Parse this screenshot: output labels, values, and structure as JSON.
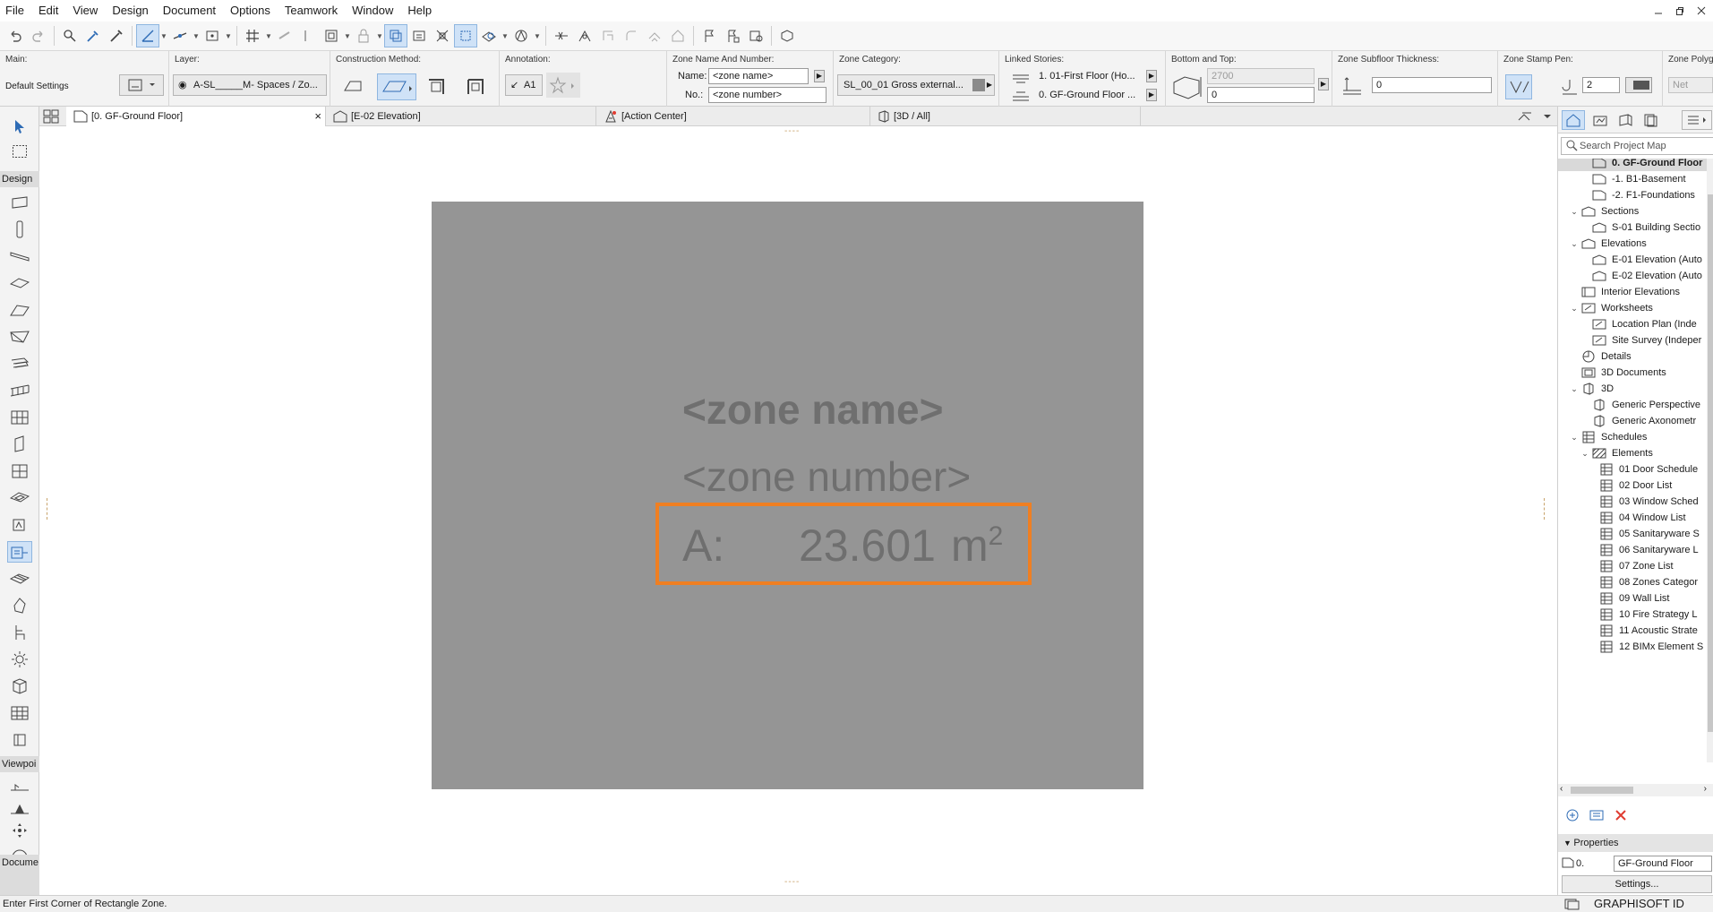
{
  "menu": [
    "File",
    "Edit",
    "View",
    "Design",
    "Document",
    "Options",
    "Teamwork",
    "Window",
    "Help"
  ],
  "window_controls": [
    "minimize-icon",
    "restore-icon",
    "close-icon"
  ],
  "infobox": {
    "main_label": "Main:",
    "main_value": "Default Settings",
    "layer_label": "Layer:",
    "layer_value": "A-SL_____M- Spaces / Zo...",
    "construction_label": "Construction Method:",
    "annotation_label": "Annotation:",
    "annotation_value": "A1",
    "zone_name_label": "Zone Name And Number:",
    "name_label": "Name:",
    "name_value": "<zone name>",
    "no_label": "No.:",
    "no_value": "<zone number>",
    "category_label": "Zone Category:",
    "category_value": "SL_00_01   Gross external...",
    "linked_label": "Linked Stories:",
    "linked_top": "1. 01-First Floor (Ho...",
    "linked_bottom": "0. GF-Ground Floor ...",
    "bt_label": "Bottom and Top:",
    "top_value": "2700",
    "bottom_value": "0",
    "subfloor_label": "Zone Subfloor Thickness:",
    "subfloor_value": "0",
    "stamp_label": "Zone Stamp Pen:",
    "stamp_value": "2",
    "polygon_label": "Zone Polygon",
    "polygon_value": "Net"
  },
  "toolbox": {
    "design_label": "Design",
    "viewpoint_label": "Viewpoi",
    "document_label": "Docume"
  },
  "tabs": [
    {
      "label": "[0. GF-Ground Floor]",
      "close": "×"
    },
    {
      "label": "[E-02 Elevation]"
    },
    {
      "label": "[Action Center]"
    },
    {
      "label": "[3D / All]"
    }
  ],
  "zone_stamp": {
    "name": "<zone name>",
    "number": "<zone number>",
    "area_label": "A:",
    "area_value": "23.601",
    "area_unit": "m",
    "area_unit_power": "2",
    "highlight_color": "#ef7f22",
    "zone_fill": "#959595"
  },
  "handle_marks": "----",
  "navigator": {
    "search_placeholder": "Search Project Map",
    "items": [
      {
        "label": "0. GF-Ground Floor",
        "level": 2,
        "selected": true,
        "icon": "story-icon"
      },
      {
        "label": "-1. B1-Basement",
        "level": 2,
        "icon": "story-icon"
      },
      {
        "label": "-2. F1-Foundations",
        "level": 2,
        "icon": "story-icon"
      },
      {
        "label": "Sections",
        "level": 1,
        "expand": "v",
        "icon": "section-icon"
      },
      {
        "label": "S-01 Building Sectio",
        "level": 2,
        "icon": "section-icon"
      },
      {
        "label": "Elevations",
        "level": 1,
        "expand": "v",
        "icon": "elevation-icon"
      },
      {
        "label": "E-01 Elevation (Auto",
        "level": 2,
        "icon": "elevation-icon"
      },
      {
        "label": "E-02 Elevation (Auto",
        "level": 2,
        "icon": "elevation-icon"
      },
      {
        "label": "Interior Elevations",
        "level": 1,
        "icon": "interior-elevation-icon"
      },
      {
        "label": "Worksheets",
        "level": 1,
        "expand": "v",
        "icon": "worksheet-icon"
      },
      {
        "label": "Location Plan (Inde",
        "level": 2,
        "icon": "worksheet-icon"
      },
      {
        "label": "Site Survey (Indeper",
        "level": 2,
        "icon": "worksheet-icon"
      },
      {
        "label": "Details",
        "level": 1,
        "icon": "detail-icon"
      },
      {
        "label": "3D Documents",
        "level": 1,
        "icon": "3d-document-icon"
      },
      {
        "label": "3D",
        "level": 1,
        "expand": "v",
        "icon": "3d-icon"
      },
      {
        "label": "Generic Perspective",
        "level": 2,
        "icon": "perspective-icon"
      },
      {
        "label": "Generic Axonometr",
        "level": 2,
        "icon": "axonometry-icon"
      },
      {
        "label": "Schedules",
        "level": 1,
        "expand": "v",
        "icon": "schedule-icon"
      },
      {
        "label": "Elements",
        "level": 2,
        "expand": "v",
        "icon": "elements-icon"
      },
      {
        "label": "01 Door Schedule",
        "level": 3,
        "icon": "schedule-icon"
      },
      {
        "label": "02 Door List",
        "level": 3,
        "icon": "schedule-icon"
      },
      {
        "label": "03 Window Sched",
        "level": 3,
        "icon": "schedule-icon"
      },
      {
        "label": "04 Window List",
        "level": 3,
        "icon": "schedule-icon"
      },
      {
        "label": "05 Sanitaryware S",
        "level": 3,
        "icon": "schedule-icon"
      },
      {
        "label": "06 Sanitaryware L",
        "level": 3,
        "icon": "schedule-icon"
      },
      {
        "label": "07 Zone List",
        "level": 3,
        "icon": "schedule-icon"
      },
      {
        "label": "08 Zones Categor",
        "level": 3,
        "icon": "schedule-icon"
      },
      {
        "label": "09 Wall List",
        "level": 3,
        "icon": "schedule-icon"
      },
      {
        "label": "10 Fire Strategy L",
        "level": 3,
        "icon": "schedule-icon"
      },
      {
        "label": "11 Acoustic Strate",
        "level": 3,
        "icon": "schedule-icon"
      },
      {
        "label": "12 BIMx Element S",
        "level": 3,
        "icon": "schedule-icon"
      }
    ],
    "properties_label": "Properties",
    "properties_id": "0.",
    "properties_value": "GF-Ground Floor",
    "settings_label": "Settings..."
  },
  "status": {
    "message": "Enter First Corner of Rectangle Zone.",
    "graphisoft_id": "GRAPHISOFT ID"
  }
}
